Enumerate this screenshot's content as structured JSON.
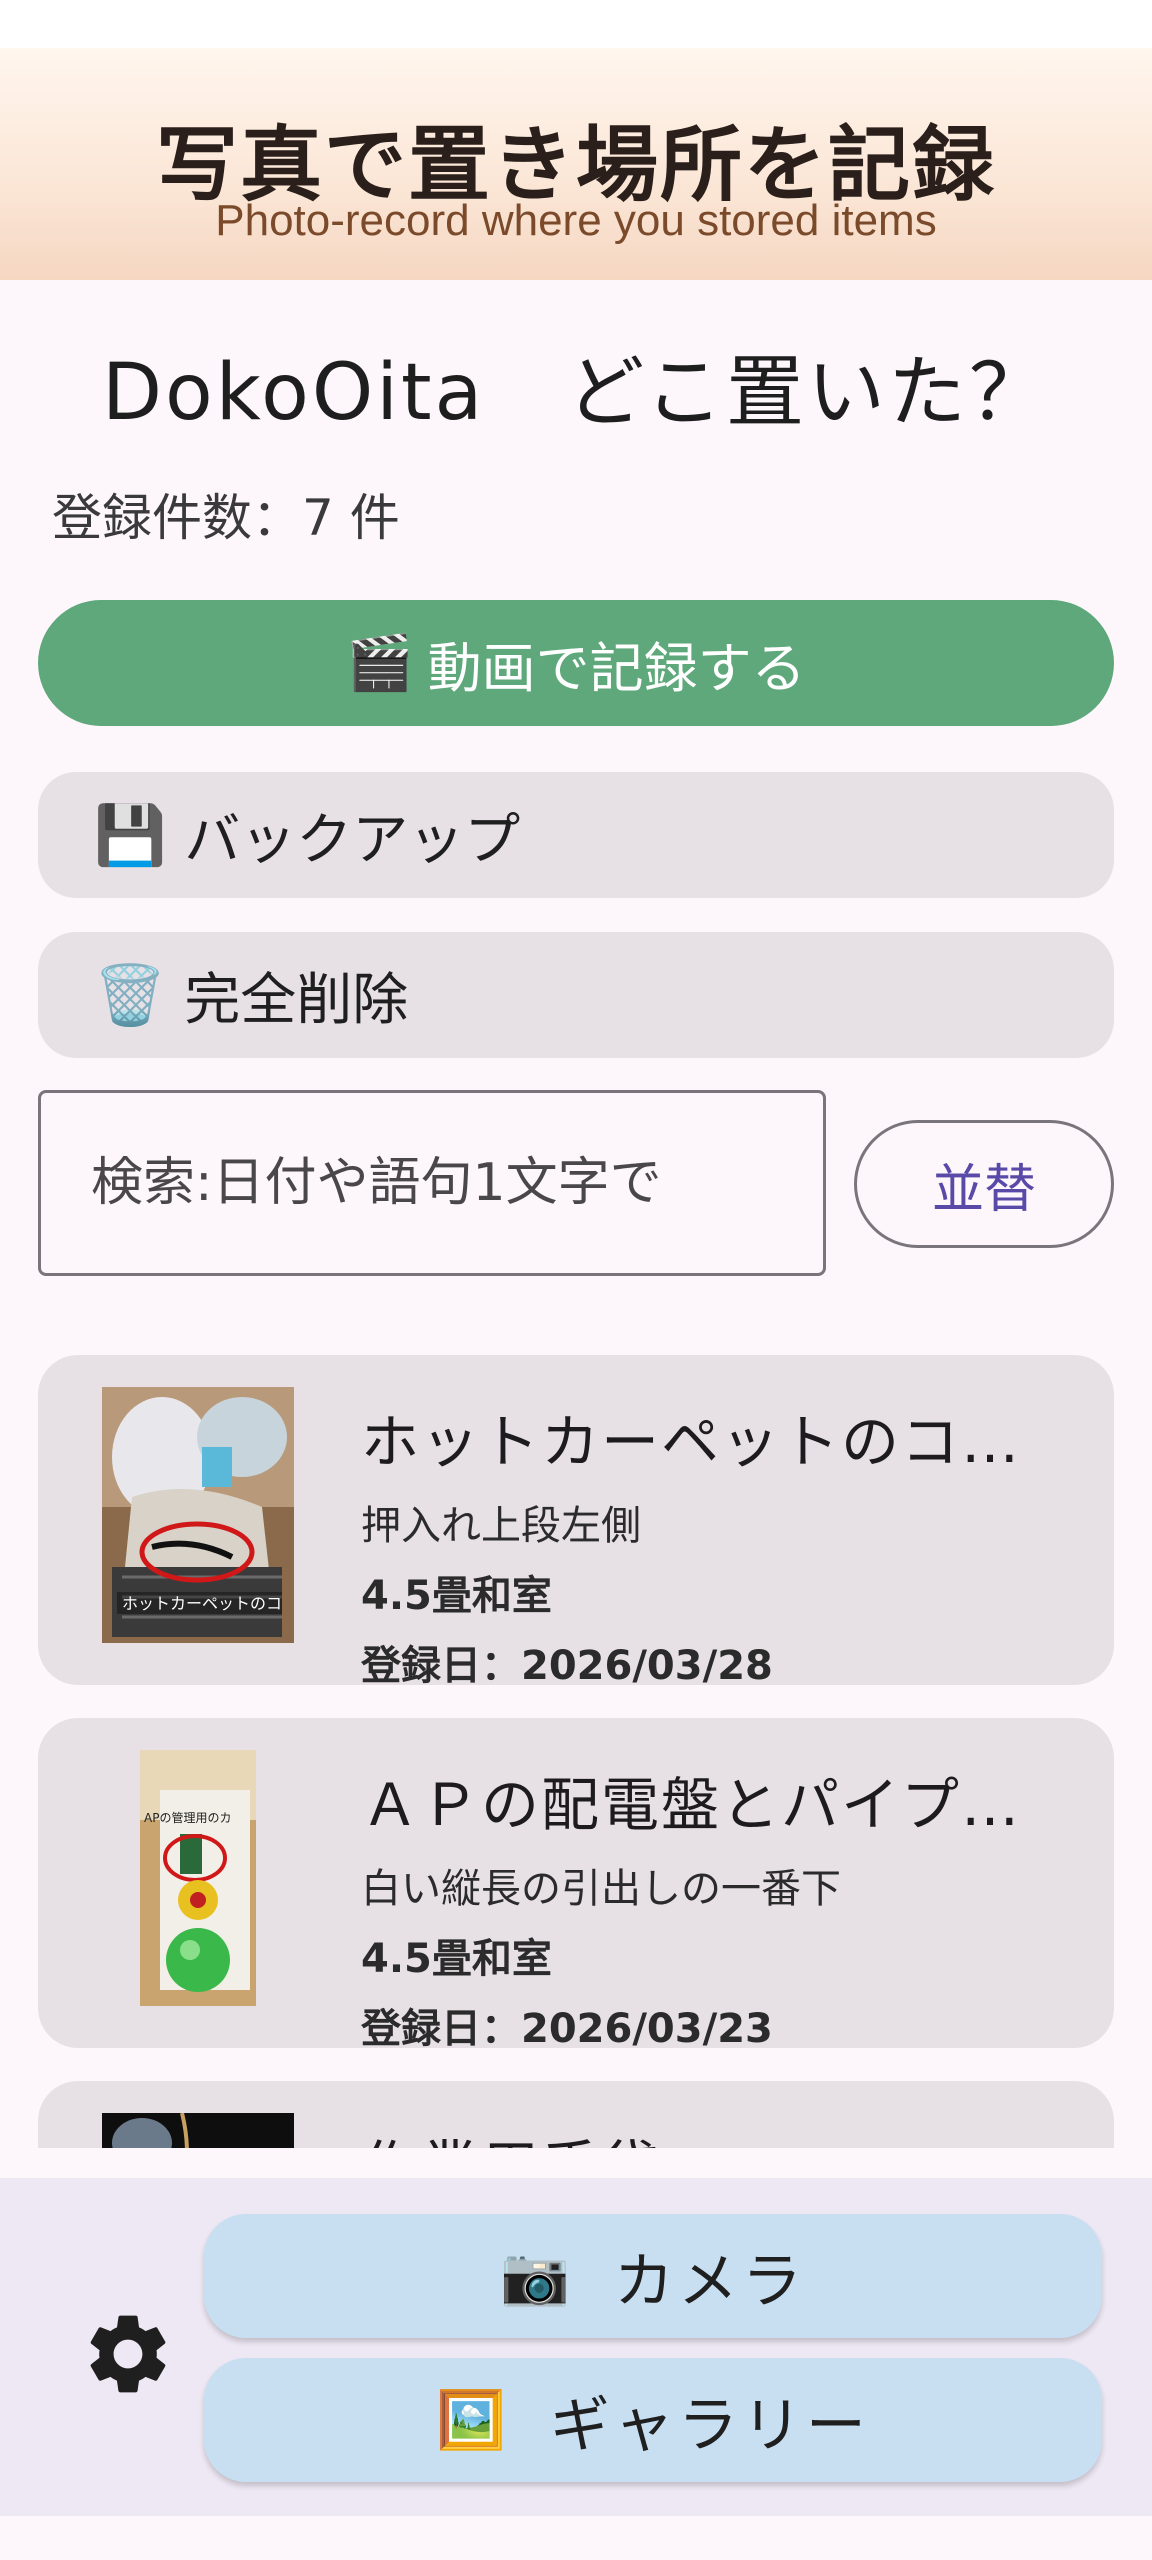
{
  "banner": {
    "title": "写真で置き場所を記録",
    "subtitle": "Photo-record where you stored items"
  },
  "app": {
    "title": "DokoOita　どこ置いた？",
    "count_text": "登録件数：7 件"
  },
  "buttons": {
    "record_video": "動画で記録する",
    "record_video_icon": "🎬",
    "backup": "バックアップ",
    "backup_icon": "💾",
    "delete_all": "完全削除",
    "delete_all_icon": "🗑️",
    "sort": "並替"
  },
  "search": {
    "placeholder": "検索:日付や語句1文字で",
    "value": ""
  },
  "items": [
    {
      "title": "ホットカーペットのコード",
      "location": "押入れ上段左側",
      "room": "4.5畳和室",
      "date": "登録日：2026/03/28"
    },
    {
      "title": "ＡＰの配電盤とパイプシャフト",
      "location": "白い縦長の引出しの一番下",
      "room": "4.5畳和室",
      "date": "登録日：2026/03/23"
    },
    {
      "title": "作業用手袋",
      "location": "",
      "room": "",
      "date": ""
    }
  ],
  "bottom_bar": {
    "camera": "カメラ",
    "camera_icon": "📷",
    "gallery": "ギャラリー",
    "gallery_icon": "🖼️",
    "settings_icon": "gear-icon"
  },
  "colors": {
    "primary_button": "#5ea87b",
    "tonal_button": "#e7e1e6",
    "sort_text": "#5a4aa8",
    "nav_button": "#c8dff2"
  }
}
